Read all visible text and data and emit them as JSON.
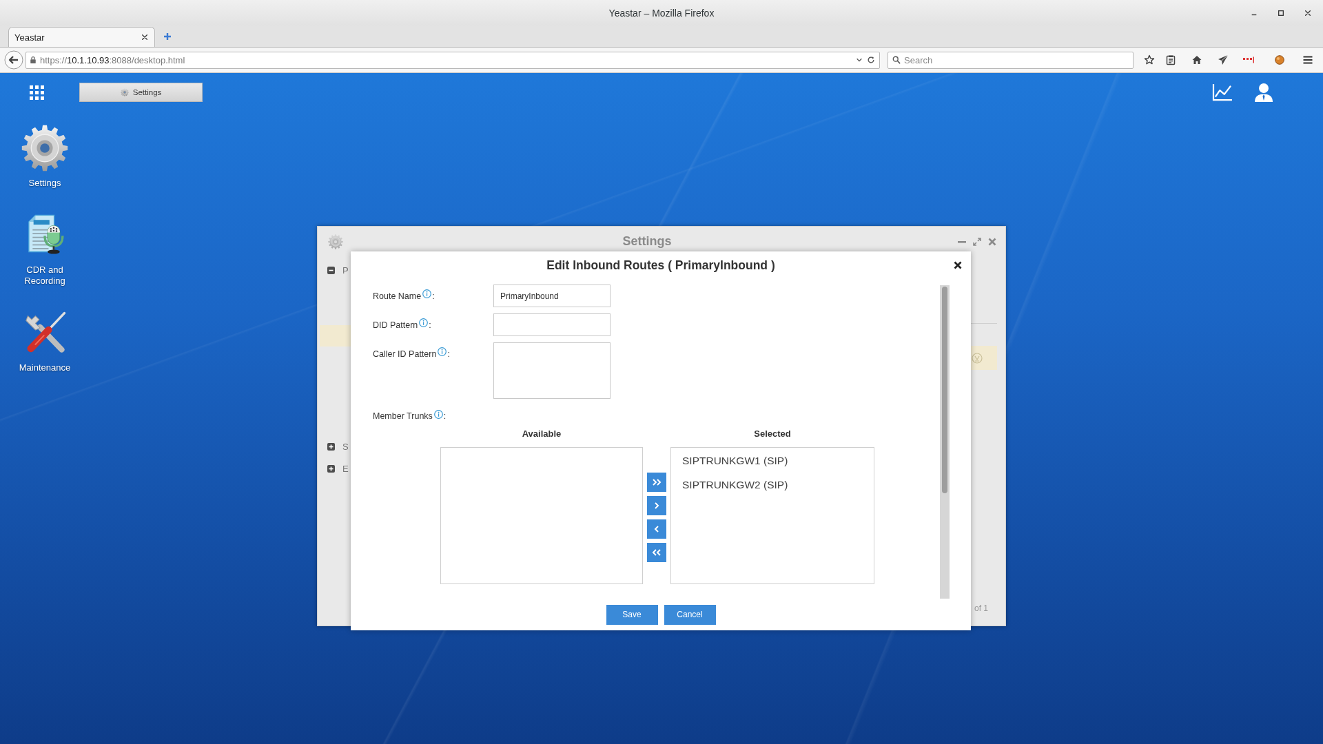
{
  "browser": {
    "title": "Yeastar – Mozilla Firefox",
    "tabs": [
      {
        "label": "Yeastar",
        "selected": true
      }
    ],
    "url": {
      "scheme": "https://",
      "host": "10.1.10.93",
      "path": ":8088/desktop.html"
    },
    "search": {
      "placeholder": "Search"
    }
  },
  "desktop": {
    "taskbar": [
      {
        "label": "Settings"
      }
    ],
    "shortcuts": [
      {
        "label": "Settings",
        "kind": "settings"
      },
      {
        "label": "CDR and Recording",
        "kind": "cdr"
      },
      {
        "label": "Maintenance",
        "kind": "maintenance"
      }
    ]
  },
  "settings_window": {
    "title": "Settings",
    "tree": [
      {
        "label": "P",
        "expanded": true,
        "children": [
          {
            "selected": true
          }
        ]
      },
      {
        "label": "S",
        "expanded": false
      },
      {
        "label": "E",
        "expanded": false
      }
    ],
    "table": {
      "rows": [
        {
          "selected": true
        }
      ]
    },
    "pager": "of 1"
  },
  "dialog": {
    "title": "Edit Inbound Routes ( PrimaryInbound )",
    "fields": [
      {
        "label": "Route Name",
        "suffix": ":",
        "kind": "input",
        "value": "PrimaryInbound"
      },
      {
        "label": "DID Pattern",
        "suffix": ":",
        "kind": "input"
      },
      {
        "label": "Caller ID Pattern",
        "suffix": ":",
        "kind": "textarea"
      }
    ],
    "member_trunks": {
      "label": "Member Trunks",
      "suffix": ":",
      "available": {
        "heading": "Available"
      },
      "selected": {
        "heading": "Selected",
        "items": [
          "SIPTRUNKGW1 (SIP)",
          "SIPTRUNKGW2 (SIP)"
        ]
      },
      "move_buttons": [
        {
          "kind": "add_all"
        },
        {
          "kind": "add"
        },
        {
          "kind": "remove"
        },
        {
          "kind": "remove_all"
        }
      ]
    },
    "buttons": [
      "Save",
      "Cancel"
    ]
  }
}
